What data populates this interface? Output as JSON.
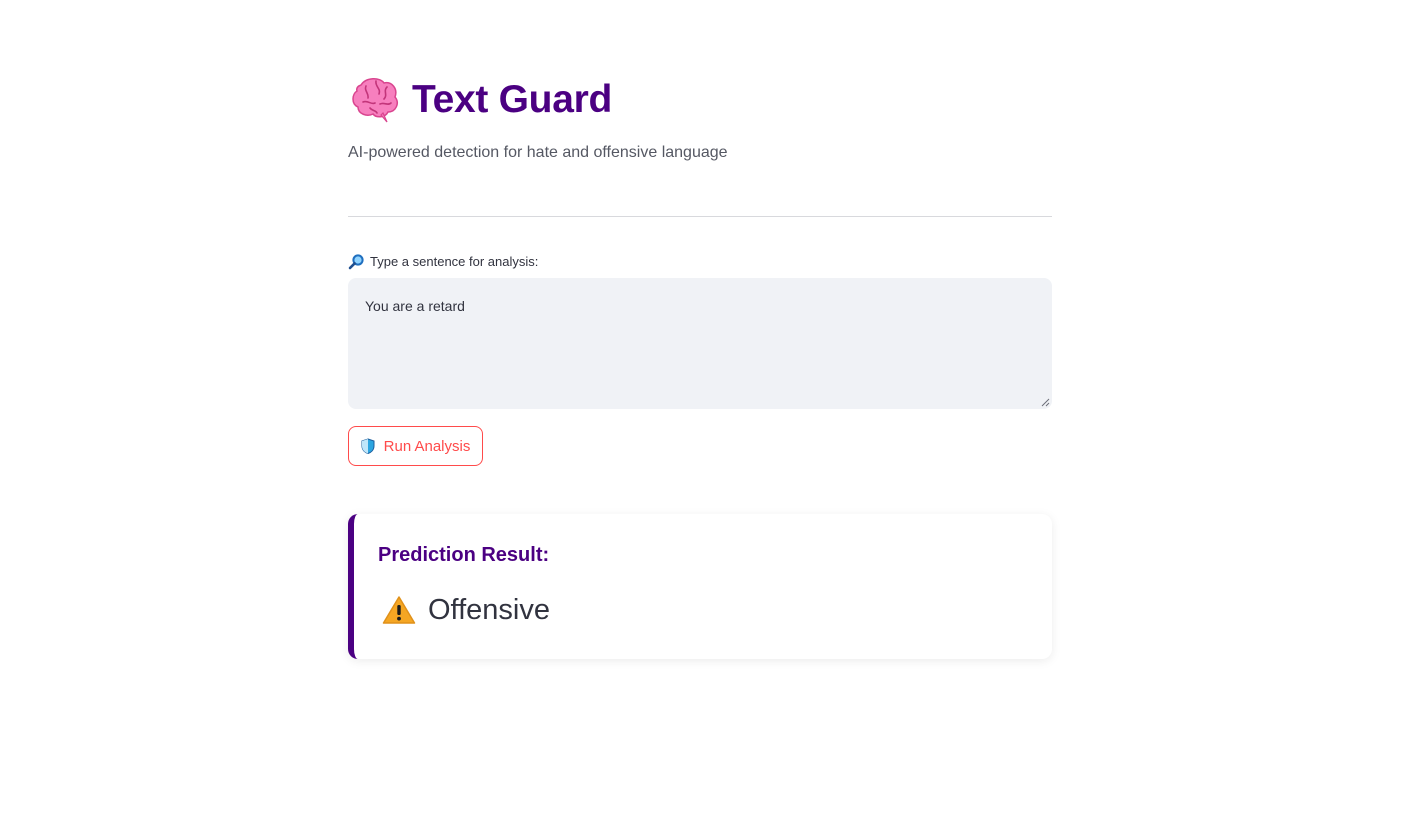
{
  "header": {
    "title_icon": "brain-icon",
    "title": "Text Guard",
    "subtitle": "AI-powered detection for hate and offensive language"
  },
  "input": {
    "label_icon": "magnifier-icon",
    "label": "Type a sentence for analysis:",
    "value": "You are a retard"
  },
  "actions": {
    "run_icon": "shield-icon",
    "run_label": "Run Analysis"
  },
  "result": {
    "heading": "Prediction Result:",
    "icon": "warning-icon",
    "label": "Offensive"
  },
  "colors": {
    "brand": "#4b0082",
    "accent": "#ff4b4b",
    "input_bg": "#f0f2f6",
    "text": "#31333f",
    "warning": "#f5a623"
  }
}
